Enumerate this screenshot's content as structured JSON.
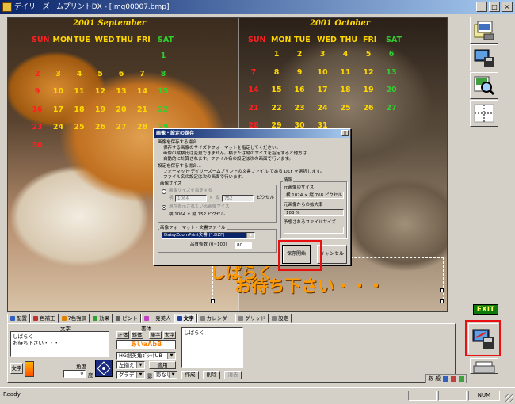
{
  "window": {
    "title": "デイリーズームプリントDX - [img00007.bmp]",
    "buttons": [
      "_",
      "□",
      "×"
    ]
  },
  "canvas": {
    "left_calendar": {
      "month": "2001 September",
      "weekdays": [
        "SUN",
        "MON",
        "TUE",
        "WED",
        "THU",
        "FRI",
        "SAT"
      ],
      "weekday_colors": [
        "#ff2020",
        "#ffd700",
        "#ffd700",
        "#ffd700",
        "#ffd700",
        "#ffd700",
        "#30d030"
      ],
      "rows": [
        [
          "",
          "",
          "",
          "",
          "",
          "",
          "1"
        ],
        [
          "2",
          "3",
          "4",
          "5",
          "6",
          "7",
          "8"
        ],
        [
          "9",
          "10",
          "11",
          "12",
          "13",
          "14",
          "15"
        ],
        [
          "16",
          "17",
          "18",
          "19",
          "20",
          "21",
          "22"
        ],
        [
          "23",
          "24",
          "25",
          "26",
          "27",
          "28",
          "29"
        ],
        [
          "30",
          "",
          "",
          "",
          "",
          "",
          ""
        ]
      ]
    },
    "right_calendar": {
      "month": "2001 October",
      "weekdays": [
        "SUN",
        "MON",
        "TUE",
        "WED",
        "THU",
        "FRI",
        "SAT"
      ],
      "weekday_colors": [
        "#ff2020",
        "#ffd700",
        "#ffd700",
        "#ffd700",
        "#ffd700",
        "#ffd700",
        "#30d030"
      ],
      "rows": [
        [
          "",
          "1",
          "2",
          "3",
          "4",
          "5",
          "6"
        ],
        [
          "7",
          "8",
          "9",
          "10",
          "11",
          "12",
          "13"
        ],
        [
          "14",
          "15",
          "16",
          "17",
          "18",
          "19",
          "20"
        ],
        [
          "21",
          "22",
          "23",
          "24",
          "25",
          "26",
          "27"
        ],
        [
          "28",
          "29",
          "30",
          "31",
          "",
          "",
          ""
        ]
      ]
    },
    "message_line1": "しばらく",
    "message_line2": "お待ち下さい・・・"
  },
  "dialog": {
    "title": "画像・設定の保存",
    "intro_heading": "画像を保存する場合…",
    "intro_lines": [
      "保存する画像のサイズやフォーマットを指定してください。",
      "画像の縦横比は変更できません。横または縦のサイズを指定すると他方は",
      "自動的に計算されます。ファイル名の設定は次の画面で行います。"
    ],
    "settings_heading": "設定を保存する場合…",
    "settings_lines": [
      "フォーマット'デイリーズームプリントの文書ファイル'である DZF を選択します。",
      "ファイル名の設定は次の画面で行います。"
    ],
    "size_group": "画像サイズ",
    "radio_specify": "画像サイズを指定する",
    "width_label": "横",
    "width_value": "1064",
    "height_label": "縦",
    "height_value": "752",
    "unit_pixel": "ピクセル",
    "radio_keep": "現在表示されている画像サイズ",
    "current_size_label": "横 1064 × 縦 752 ピクセル",
    "info_group": "情報",
    "orig_size_heading": "元画像のサイズ",
    "orig_size_value": "横 1024 × 縦 768 ピクセル",
    "scale_heading": "元画像からの拡大率",
    "scale_value": "103 %",
    "filesize_heading": "予想されるファイルサイズ",
    "filesize_value": "",
    "format_group": "画像フォーマット・文書ファイル",
    "format_value": "DaisyZoomPrint文書 (*.DZF)",
    "quality_label": "品質係数 (0~100)",
    "quality_value": "80",
    "save_button": "保存開始",
    "cancel_button": "キャンセル"
  },
  "tools": {
    "exit_label": "EXIT"
  },
  "tabs": [
    {
      "label": "配置",
      "color": "#3060c0"
    },
    {
      "label": "色補正",
      "color": "#c03030"
    },
    {
      "label": "7色強調",
      "color": "#e08000"
    },
    {
      "label": "効果",
      "color": "#30a030"
    },
    {
      "label": "ピント",
      "color": "#606060"
    },
    {
      "label": "一発美人",
      "color": "#c040c0"
    },
    {
      "label": "文字",
      "color": "#2040a0"
    },
    {
      "label": "カレンダー",
      "color": "#808080"
    },
    {
      "label": "グリッド",
      "color": "#808080"
    },
    {
      "label": "設定",
      "color": "#808080"
    }
  ],
  "active_tab": "文字",
  "text_panel": {
    "text_heading": "文字",
    "text_value_line1": "しばらく",
    "text_value_line2": "お待ち下さい・・・",
    "font_heading": "書体",
    "style_buttons": [
      "正体",
      "斜体",
      "横字",
      "太字"
    ],
    "font_sample": "あいaAbB",
    "font_name": "HG創英角ｺﾞｼｯｸUB",
    "align_value": "左揃え",
    "apply_button": "適用",
    "gradient_value": "グラデ",
    "shadow_value": "影",
    "border_value": "影なし",
    "color_button": "文字",
    "angle_heading": "角度",
    "angle_value": "0",
    "angle_unit": "度",
    "list_item": "しばらく",
    "create_button": "作成",
    "delete_button": "削除",
    "clear_button": "消去"
  },
  "statusbar": {
    "text": "Ready",
    "num": "NUM"
  },
  "ime_text": "あ 般"
}
